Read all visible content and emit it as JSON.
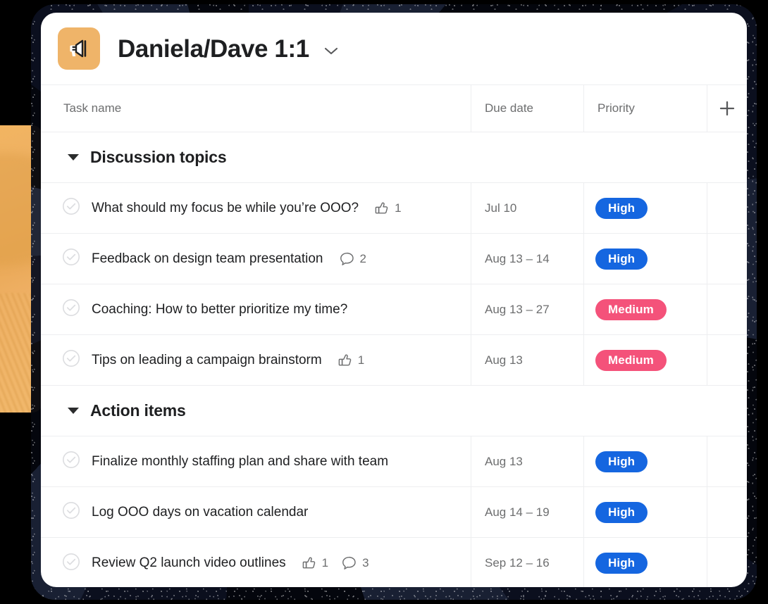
{
  "header": {
    "project_icon": "megaphone-icon",
    "project_icon_color": "#efb469",
    "title": "Daniela/Dave 1:1",
    "chevron": "chevron-down-icon"
  },
  "table": {
    "columns": {
      "task_name": "Task name",
      "due_date": "Due date",
      "priority": "Priority",
      "add": "plus-icon"
    },
    "sections": [
      {
        "title": "Discussion topics",
        "collapsed": false,
        "rows": [
          {
            "name": "What should my focus be while you’re OOO?",
            "likes": "1",
            "comments": "",
            "due": "Jul 10",
            "priority": "High",
            "priority_color": "#1566e0"
          },
          {
            "name": "Feedback on design team presentation",
            "likes": "",
            "comments": "2",
            "due": "Aug 13 – 14",
            "priority": "High",
            "priority_color": "#1566e0"
          },
          {
            "name": "Coaching: How to better prioritize my time?",
            "likes": "",
            "comments": "",
            "due": "Aug 13 – 27",
            "priority": "Medium",
            "priority_color": "#f4527a"
          },
          {
            "name": "Tips on leading a campaign brainstorm",
            "likes": "1",
            "comments": "",
            "due": "Aug 13",
            "priority": "Medium",
            "priority_color": "#f4527a"
          }
        ]
      },
      {
        "title": "Action items",
        "collapsed": false,
        "rows": [
          {
            "name": "Finalize monthly staffing plan and share with team",
            "likes": "",
            "comments": "",
            "due": "Aug 13",
            "priority": "High",
            "priority_color": "#1566e0"
          },
          {
            "name": "Log OOO days on vacation calendar",
            "likes": "",
            "comments": "",
            "due": "Aug 14 – 19",
            "priority": "High",
            "priority_color": "#1566e0"
          },
          {
            "name": "Review Q2 launch video outlines",
            "likes": "1",
            "comments": "3",
            "due": "Sep 12 – 16",
            "priority": "High",
            "priority_color": "#1566e0"
          }
        ]
      }
    ]
  }
}
